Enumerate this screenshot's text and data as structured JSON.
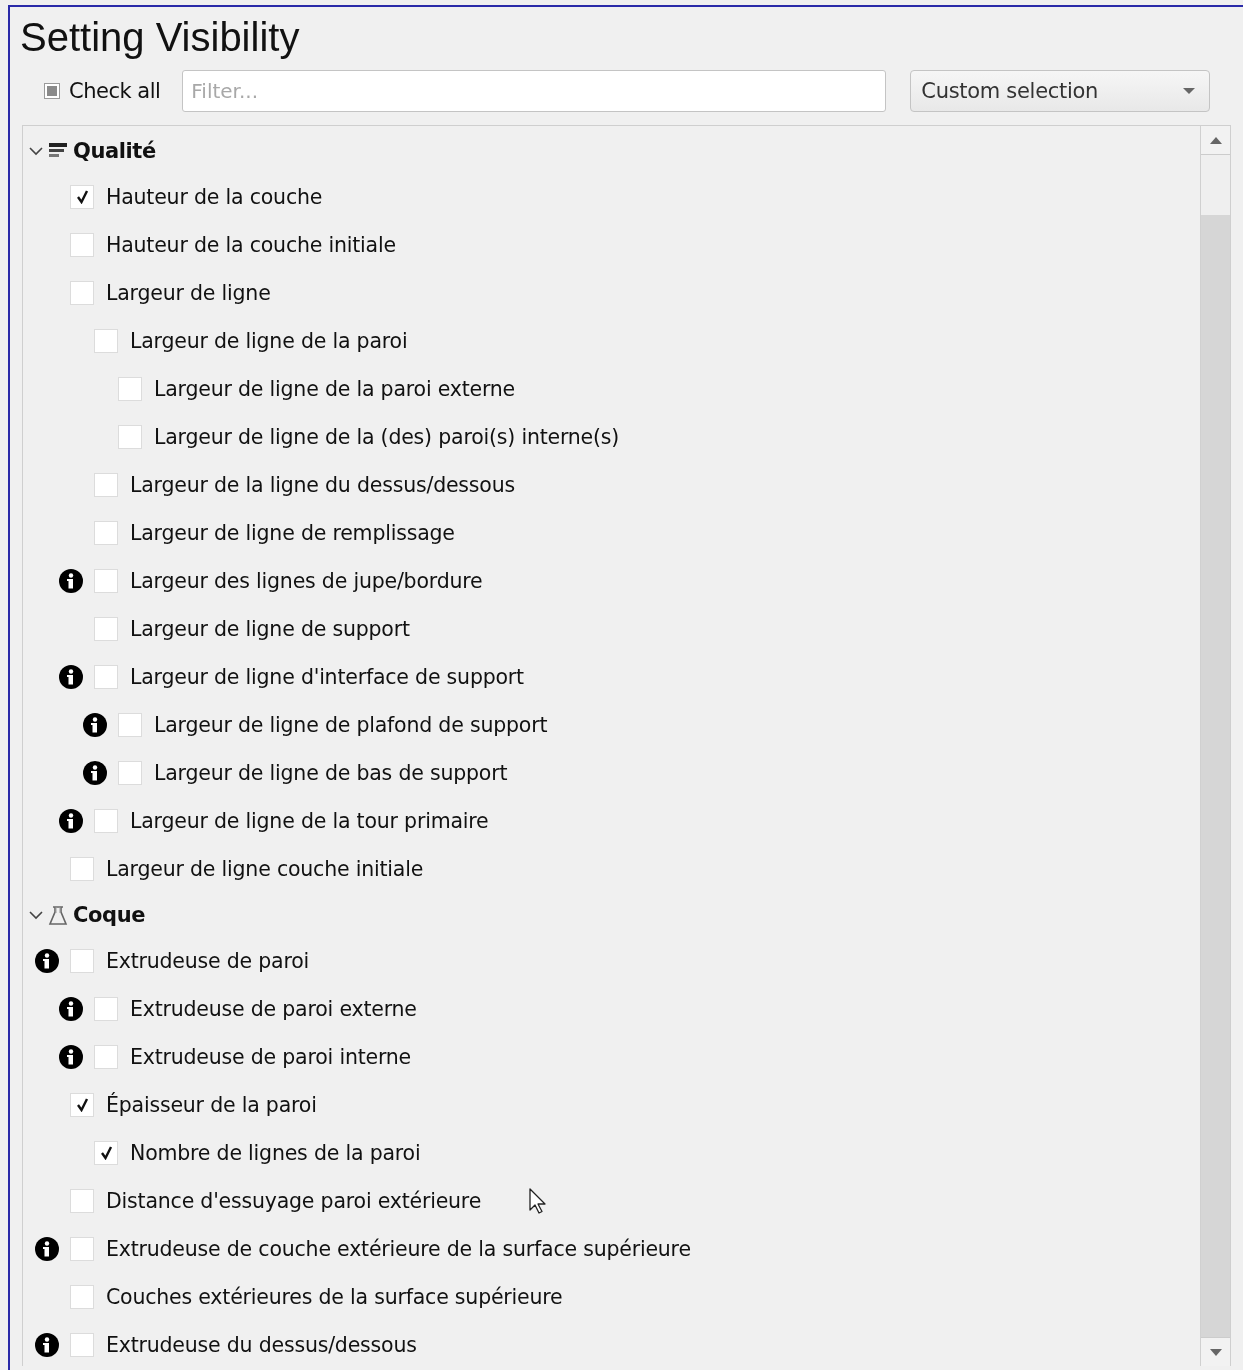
{
  "title": "Setting Visibility",
  "check_all": {
    "label": "Check all",
    "checked": false,
    "partial": true
  },
  "filter": {
    "placeholder": "Filter..."
  },
  "preset": {
    "value": "Custom selection"
  },
  "categories": [
    {
      "name": "Qualité",
      "kind": "quality",
      "expanded": true,
      "settings": [
        {
          "label": "Hauteur de la couche",
          "checked": true,
          "info": false
        },
        {
          "label": "Hauteur de la couche initiale",
          "checked": false,
          "info": false
        },
        {
          "label": "Largeur de ligne",
          "checked": false,
          "info": false,
          "children": [
            {
              "label": "Largeur de ligne de la paroi",
              "checked": false,
              "info": false,
              "children": [
                {
                  "label": "Largeur de ligne de la paroi externe",
                  "checked": false,
                  "info": false
                },
                {
                  "label": "Largeur de ligne de la (des) paroi(s) interne(s)",
                  "checked": false,
                  "info": false
                }
              ]
            },
            {
              "label": "Largeur de la ligne du dessus/dessous",
              "checked": false,
              "info": false
            },
            {
              "label": "Largeur de ligne de remplissage",
              "checked": false,
              "info": false
            },
            {
              "label": "Largeur des lignes de jupe/bordure",
              "checked": false,
              "info": true
            },
            {
              "label": "Largeur de ligne de support",
              "checked": false,
              "info": false
            },
            {
              "label": "Largeur de ligne d'interface de support",
              "checked": false,
              "info": true,
              "children": [
                {
                  "label": "Largeur de ligne de plafond de support",
                  "checked": false,
                  "info": true
                },
                {
                  "label": "Largeur de ligne de bas de support",
                  "checked": false,
                  "info": true
                }
              ]
            },
            {
              "label": "Largeur de ligne de la tour primaire",
              "checked": false,
              "info": true
            }
          ]
        },
        {
          "label": "Largeur de ligne couche initiale",
          "checked": false,
          "info": false
        }
      ]
    },
    {
      "name": "Coque",
      "kind": "shell",
      "expanded": true,
      "settings": [
        {
          "label": "Extrudeuse de paroi",
          "checked": false,
          "info": true,
          "children": [
            {
              "label": "Extrudeuse de paroi externe",
              "checked": false,
              "info": true
            },
            {
              "label": "Extrudeuse de paroi interne",
              "checked": false,
              "info": true
            }
          ]
        },
        {
          "label": "Épaisseur de la paroi",
          "checked": true,
          "info": false,
          "children": [
            {
              "label": "Nombre de lignes de la paroi",
              "checked": true,
              "info": false
            }
          ]
        },
        {
          "label": "Distance d'essuyage paroi extérieure",
          "checked": false,
          "info": false
        },
        {
          "label": "Extrudeuse de couche extérieure de la surface supérieure",
          "checked": false,
          "info": true
        },
        {
          "label": "Couches extérieures de la surface supérieure",
          "checked": false,
          "info": false
        },
        {
          "label": "Extrudeuse du dessus/dessous",
          "checked": false,
          "info": true
        }
      ]
    }
  ]
}
